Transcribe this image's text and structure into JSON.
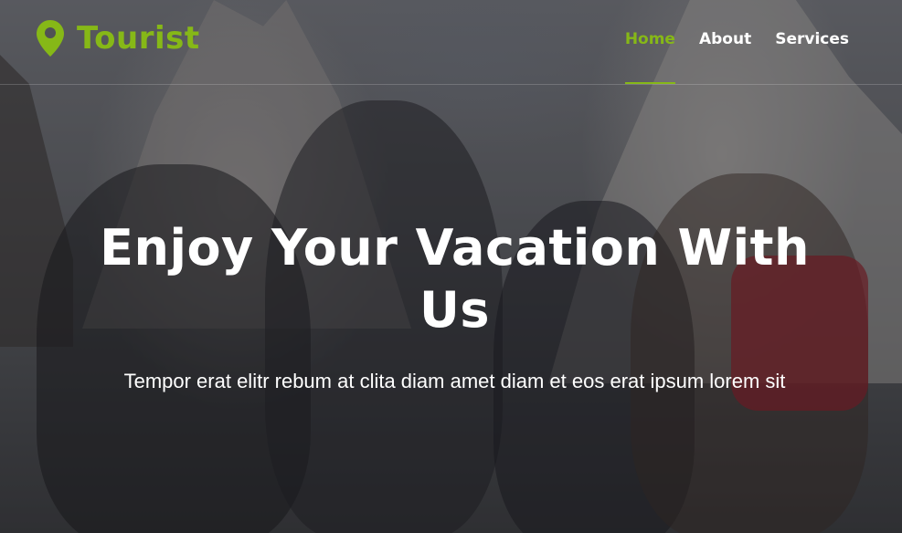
{
  "brand": {
    "name": "Tourist",
    "icon": "map-marker-icon",
    "accent_color": "#86b817"
  },
  "nav": {
    "items": [
      {
        "label": "Home",
        "active": true
      },
      {
        "label": "About",
        "active": false
      },
      {
        "label": "Services",
        "active": false
      }
    ]
  },
  "hero": {
    "title": "Enjoy Your Vacation With Us",
    "subtitle": "Tempor erat elitr rebum at clita diam amet diam et eos erat ipsum lorem sit"
  }
}
